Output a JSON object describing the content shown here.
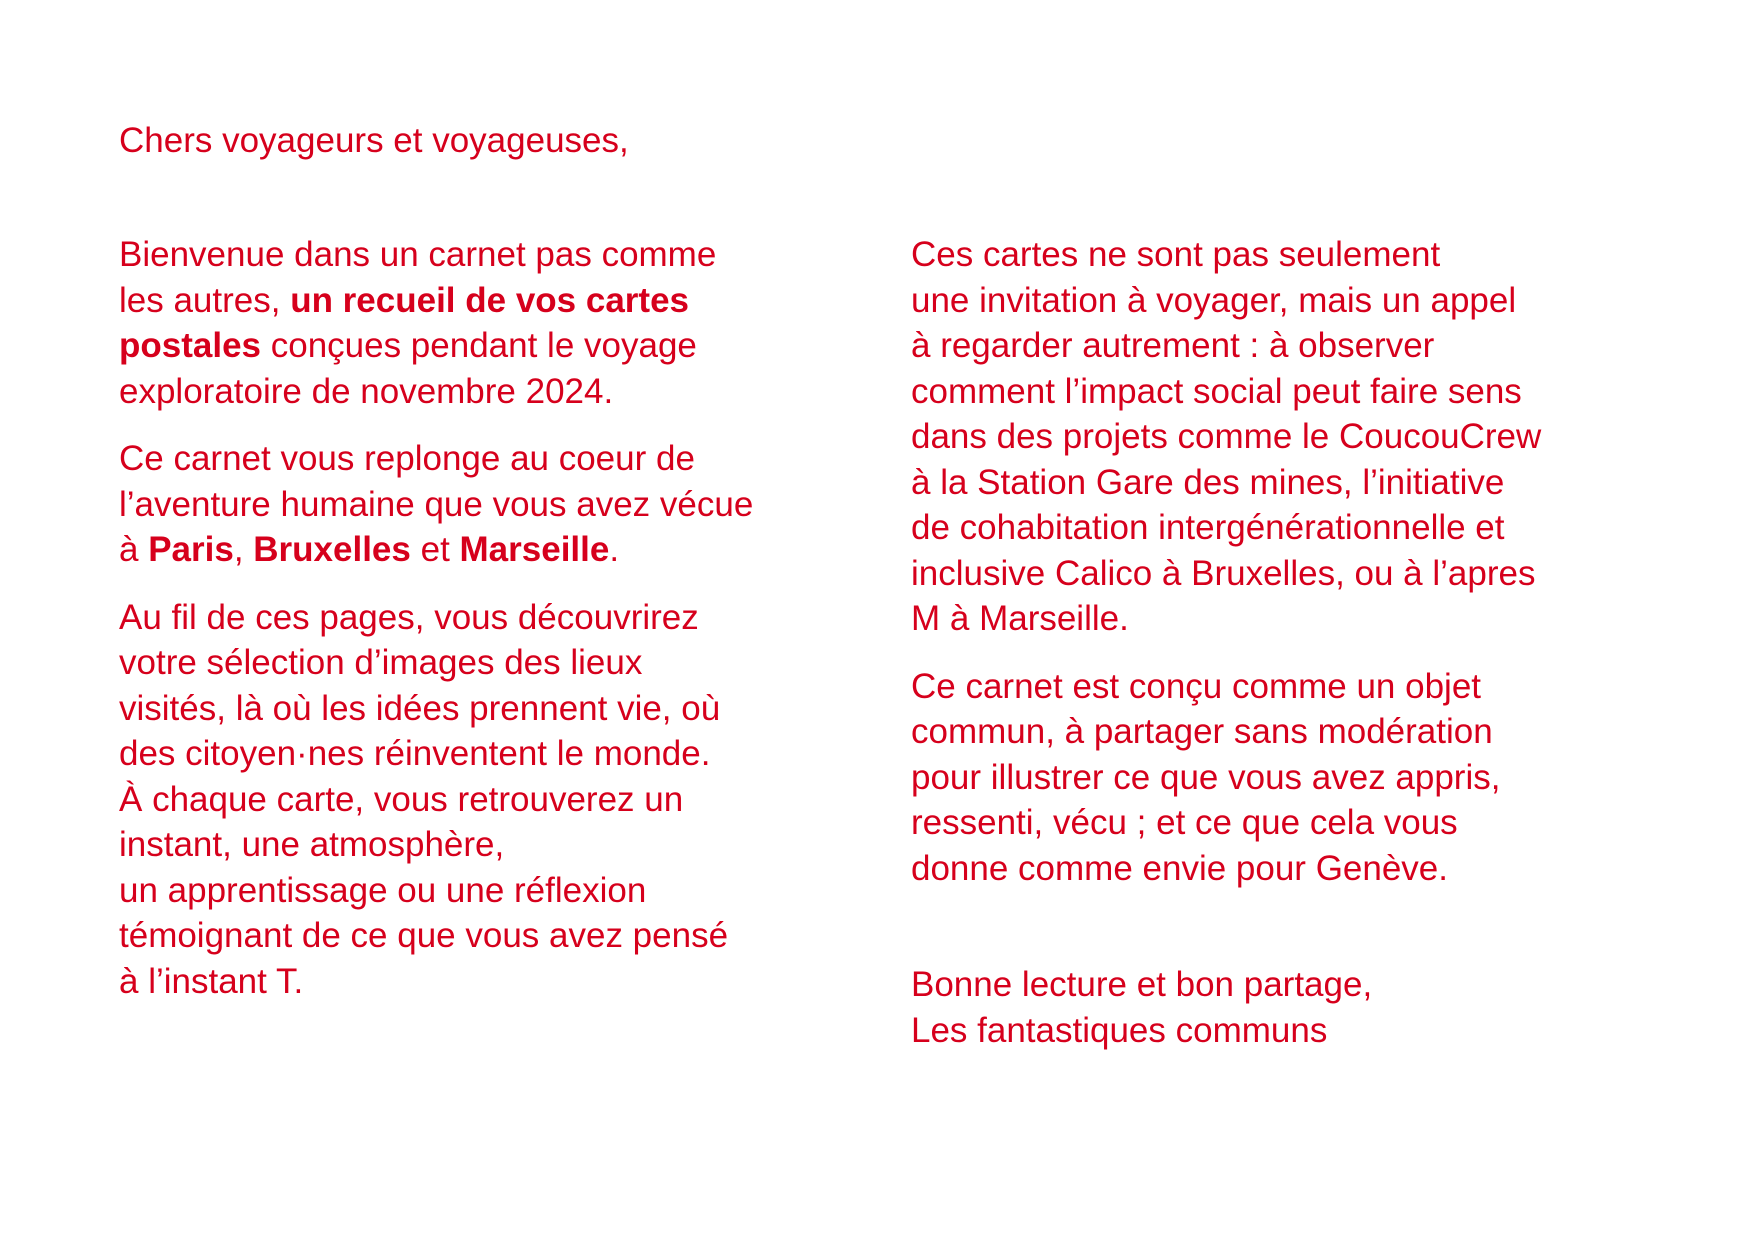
{
  "document": {
    "accent_color": "#d6001c",
    "greeting": "Chers voyageurs et voyageuses,",
    "left_column": {
      "p1": {
        "l1": "Bienvenue dans un carnet pas comme",
        "l2a": "les autres, ",
        "l2b": "un recueil de vos cartes",
        "l3a": "postales",
        "l3b": " conçues pendant le voyage",
        "l4": "exploratoire de novembre 2024."
      },
      "p2": {
        "l1": "Ce carnet vous replonge au coeur de",
        "l2": "l’aventure humaine que vous avez vécue",
        "l3a": "à ",
        "l3b": "Paris",
        "l3c": ", ",
        "l3d": "Bruxelles",
        "l3e": " et ",
        "l3f": "Marseille",
        "l3g": "."
      },
      "p3": [
        "Au fil de ces pages, vous découvrirez",
        "votre sélection d’images des lieux",
        "visités, là où les idées prennent vie, où",
        "des citoyen·nes réinventent le monde.",
        "À chaque carte, vous retrouverez un",
        "instant, une atmosphère,",
        "un apprentissage ou une réflexion",
        "témoignant de ce que vous avez pensé",
        "à l’instant T."
      ]
    },
    "right_column": {
      "p1": [
        "Ces cartes ne sont pas seulement",
        "une invitation à voyager, mais un appel",
        "à regarder autrement : à observer",
        "comment l’impact social peut faire sens",
        "dans des projets comme le CoucouCrew",
        "à la Station Gare des mines, l’initiative",
        "de cohabitation intergénérationnelle et",
        "inclusive Calico à Bruxelles, ou à l’apres",
        "M à Marseille."
      ],
      "p2": [
        "Ce carnet est conçu comme un objet",
        "commun, à partager sans modération",
        "pour illustrer ce que vous avez appris,",
        "ressenti, vécu ; et ce que cela vous",
        "donne comme envie pour Genève."
      ]
    },
    "closing": {
      "l1": "Bonne lecture et bon partage,",
      "l2": "Les fantastiques communs"
    }
  }
}
